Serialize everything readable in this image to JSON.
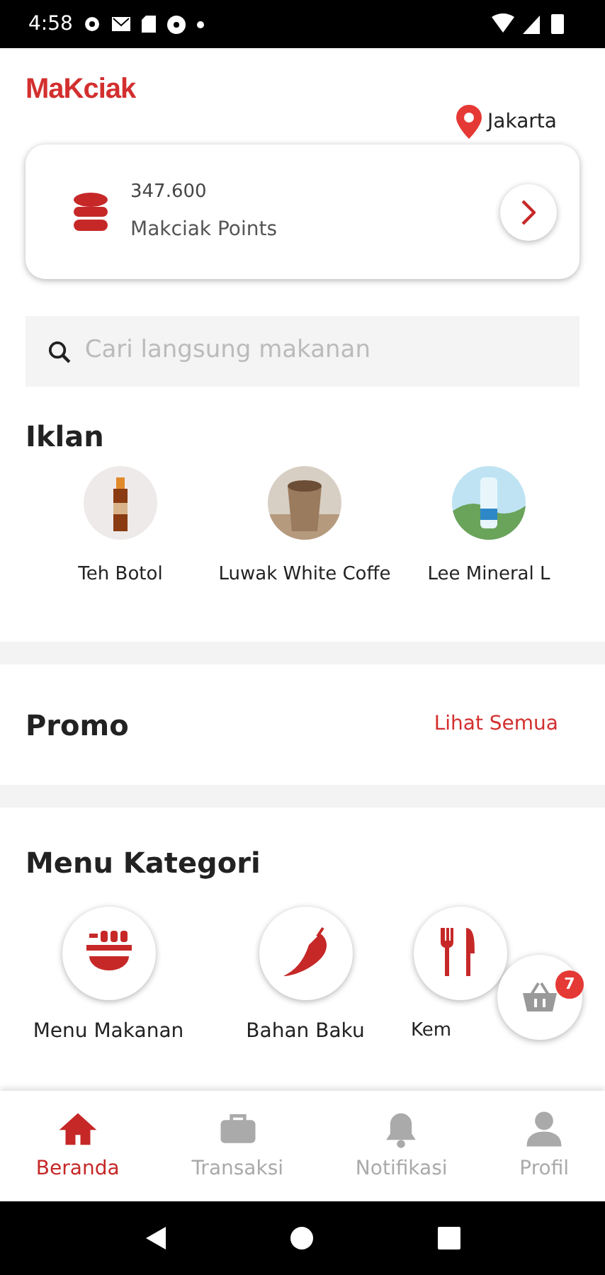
{
  "status_bar": {
    "time": "4:58"
  },
  "header": {
    "logo": "MaKciak",
    "location": "Jakarta"
  },
  "points": {
    "amount": "347.600",
    "label": "Makciak Points"
  },
  "search": {
    "placeholder": "Cari langsung makanan"
  },
  "ads": {
    "title": "Iklan",
    "items": [
      {
        "name": "Teh Botol",
        "kind": "picture"
      },
      {
        "name": "Luwak White Coffe",
        "kind": "picture"
      },
      {
        "name": "Lee Mineral L",
        "kind": "picture"
      }
    ]
  },
  "promo": {
    "title": "Promo",
    "link": "Lihat Semua"
  },
  "categories": {
    "title": "Menu Kategori",
    "items": [
      {
        "name": "Menu Makanan",
        "kind": "bowl"
      },
      {
        "name": "Bahan Baku",
        "kind": "chili"
      },
      {
        "name": "Kem",
        "kind": "cutlery"
      }
    ]
  },
  "cart": {
    "count": "7"
  },
  "bottom_nav": [
    {
      "label": "Beranda",
      "kind": "home",
      "selected": true
    },
    {
      "label": "Transaksi",
      "kind": "briefcase",
      "selected": false
    },
    {
      "label": "Notifikasi",
      "kind": "bell",
      "selected": false
    },
    {
      "label": "Profil",
      "kind": "person",
      "selected": false
    }
  ]
}
